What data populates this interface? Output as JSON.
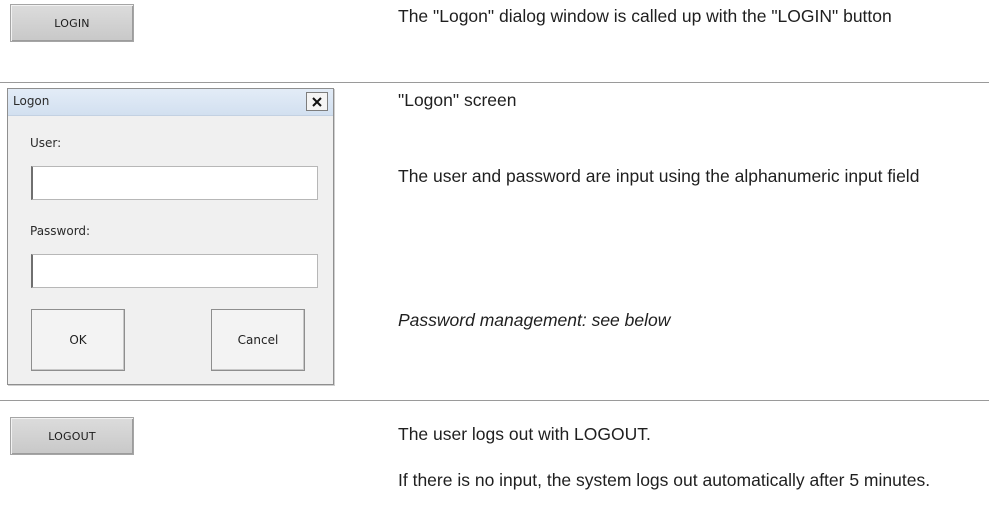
{
  "rows": {
    "login": {
      "button_label": "LOGIN",
      "description": "The \"Logon\" dialog window is called up with the \"LOGIN\" button"
    },
    "logon": {
      "heading": "\"Logon\" screen",
      "description": "The user and password are input using the alphanumeric input field",
      "note": "Password management: see below"
    },
    "logout": {
      "button_label": "LOGOUT",
      "description": "The user logs out with LOGOUT.",
      "auto_logout_note": "If there is no input, the system logs out automatically after 5 minutes."
    }
  },
  "dialog": {
    "title": "Logon",
    "close_icon": "close-icon",
    "user_label": "User:",
    "user_value": "",
    "password_label": "Password:",
    "password_value": "",
    "ok_label": "OK",
    "cancel_label": "Cancel"
  },
  "colors": {
    "divider": "#9a9a9a",
    "button_face": "#c8c8c8",
    "titlebar": "#d2e0f0"
  }
}
